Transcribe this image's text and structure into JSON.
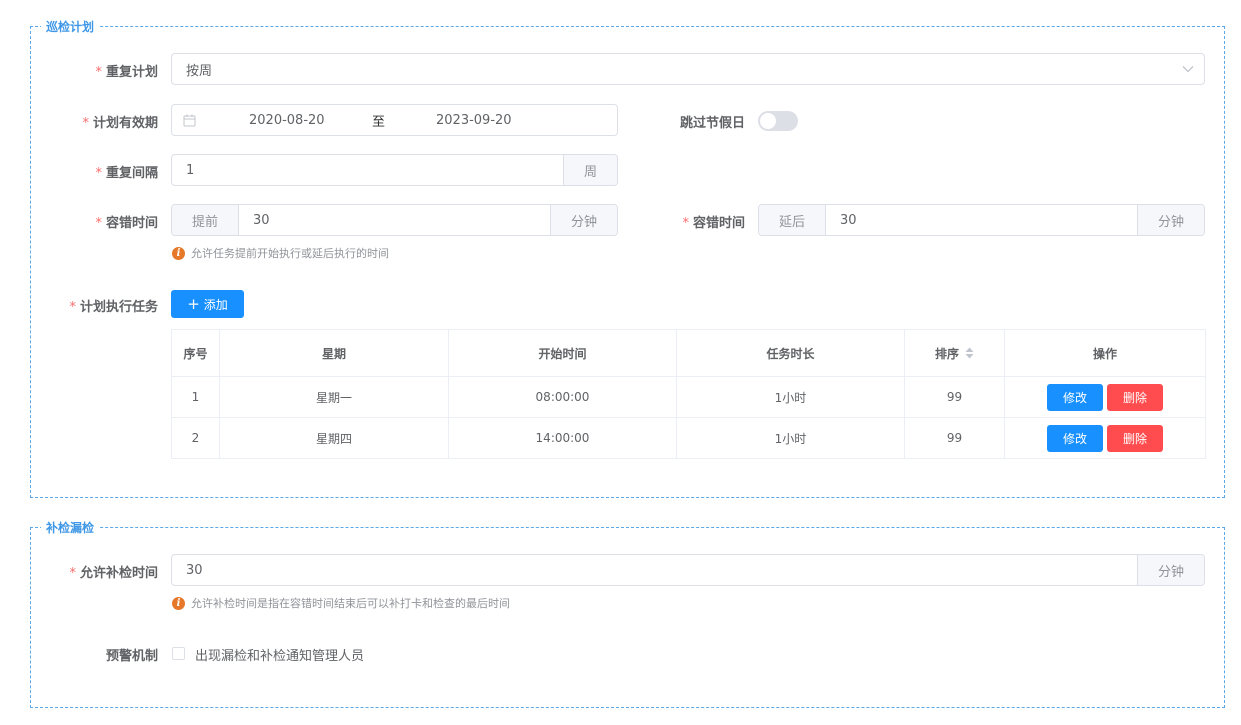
{
  "section1": {
    "legend": "巡检计划",
    "repeat_plan": {
      "label": "重复计划",
      "value": "按周"
    },
    "validity": {
      "label": "计划有效期",
      "start": "2020-08-20",
      "separator": "至",
      "end": "2023-09-20"
    },
    "skip_holidays": {
      "label": "跳过节假日",
      "enabled": false
    },
    "interval": {
      "label": "重复间隔",
      "value": "1",
      "unit": "周"
    },
    "tolerance_before": {
      "label": "容错时间",
      "prefix": "提前",
      "value": "30",
      "unit": "分钟"
    },
    "tolerance_after": {
      "label": "容错时间",
      "prefix": "延后",
      "value": "30",
      "unit": "分钟"
    },
    "tolerance_hint": "允许任务提前开始执行或延后执行的时间",
    "tasks": {
      "label": "计划执行任务",
      "add_button": "添加",
      "columns": [
        "序号",
        "星期",
        "开始时间",
        "任务时长",
        "排序",
        "操作"
      ],
      "rows": [
        {
          "no": "1",
          "weekday": "星期一",
          "start": "08:00:00",
          "duration": "1小时",
          "order": "99"
        },
        {
          "no": "2",
          "weekday": "星期四",
          "start": "14:00:00",
          "duration": "1小时",
          "order": "99"
        }
      ],
      "edit_label": "修改",
      "delete_label": "删除"
    }
  },
  "section2": {
    "legend": "补检漏检",
    "makeup_time": {
      "label": "允许补检时间",
      "value": "30",
      "unit": "分钟"
    },
    "makeup_hint": "允许补检时间是指在容错时间结束后可以补打卡和检查的最后时间",
    "warning": {
      "label": "预警机制",
      "option": "出现漏检和补检通知管理人员",
      "checked": false
    }
  },
  "colors": {
    "primary": "#1890ff",
    "danger": "#ff4d4f",
    "required": "#f56c6c",
    "legend": "#3f97e6"
  }
}
